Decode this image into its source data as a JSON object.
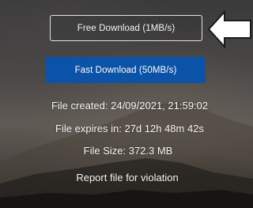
{
  "buttons": {
    "free_download": "Free Download (1MB/s)",
    "fast_download": "Fast Download (50MB/s)"
  },
  "file_info": {
    "created": "File created: 24/09/2021, 21:59:02",
    "expires": "File expires in: 27d 12h 48m 42s",
    "size": "File Size: 372.3 MB"
  },
  "report_link": "Report file for violation",
  "icons": {
    "arrow": "left-arrow-icon"
  },
  "colors": {
    "fast_download_bg": "#0a53a8",
    "text": "#ffffff"
  }
}
